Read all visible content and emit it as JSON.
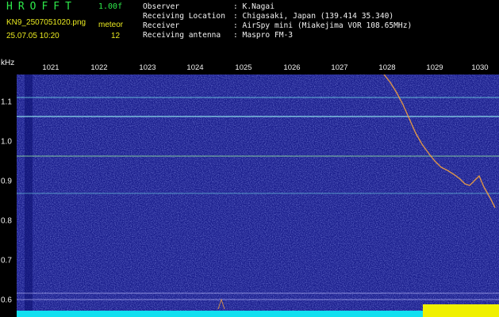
{
  "header": {
    "app_name": "HROFFT",
    "version": "1.00f",
    "filename": "KN9_2507051020.png",
    "datetime": "25.07.05 10:20",
    "meteor_label": "meteor",
    "meteor_count": "12"
  },
  "info": [
    {
      "key": "Observer",
      "value": ": K.Nagai"
    },
    {
      "key": "Receiving Location",
      "value": ": Chigasaki, Japan (139.414 35.340)"
    },
    {
      "key": "Receiver",
      "value": ": AirSpy mini (Miakejima VOR 108.65MHz)"
    },
    {
      "key": "Receiving antenna",
      "value": ": Maspro FM-3"
    }
  ],
  "axis": {
    "unit": "kHz",
    "time_ticks": [
      "1021",
      "1022",
      "1023",
      "1024",
      "1025",
      "1026",
      "1027",
      "1028",
      "1029",
      "1030"
    ],
    "freq_ticks": [
      "1.1",
      "1.0",
      "0.9",
      "0.8",
      "0.7",
      "0.6"
    ]
  },
  "colors": {
    "background": "#1a1e8c",
    "header_green": "#2ee94a",
    "header_yellow": "#eaea20",
    "trace": "#f0a040",
    "carrier": "#6fd0e0",
    "bottom_bar": "#10e0f0",
    "bottom_bar_hot": "#f0f000"
  }
}
